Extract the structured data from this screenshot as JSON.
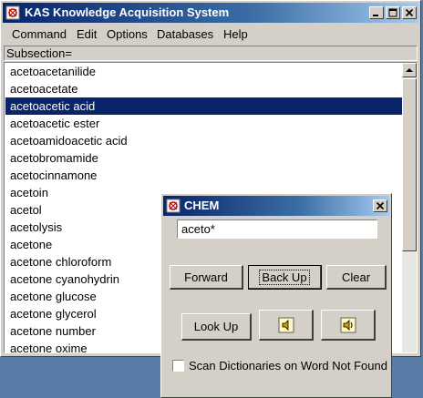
{
  "window": {
    "title": "KAS Knowledge Acquisition System"
  },
  "menu": [
    "Command",
    "Edit",
    "Options",
    "Databases",
    "Help"
  ],
  "subsection_label": "Subsection=",
  "list": {
    "items": [
      "acetoacetanilide",
      "acetoacetate",
      "acetoacetic acid",
      "acetoacetic ester",
      "acetoamidoacetic acid",
      "acetobromamide",
      "acetocinnamone",
      "acetoin",
      "acetol",
      "acetolysis",
      "acetone",
      "acetone chloroform",
      "acetone cyanohydrin",
      "acetone glucose",
      "acetone glycerol",
      "acetone number",
      "acetone oxime"
    ],
    "selected": "acetoacetic acid"
  },
  "dialog": {
    "title": "CHEM",
    "search_value": "aceto*",
    "buttons": {
      "forward": "Forward",
      "back_up": "Back Up",
      "clear": "Clear",
      "look_up": "Look Up"
    },
    "icon_buttons": [
      "speaker-icon",
      "speaker-alt-icon"
    ],
    "checkbox_label": "Scan Dictionaries on Word Not Found",
    "checkbox_checked": false
  },
  "colors": {
    "selection": "#0a246a",
    "title_bar": "#0a246a",
    "face": "#d4d0c8"
  }
}
